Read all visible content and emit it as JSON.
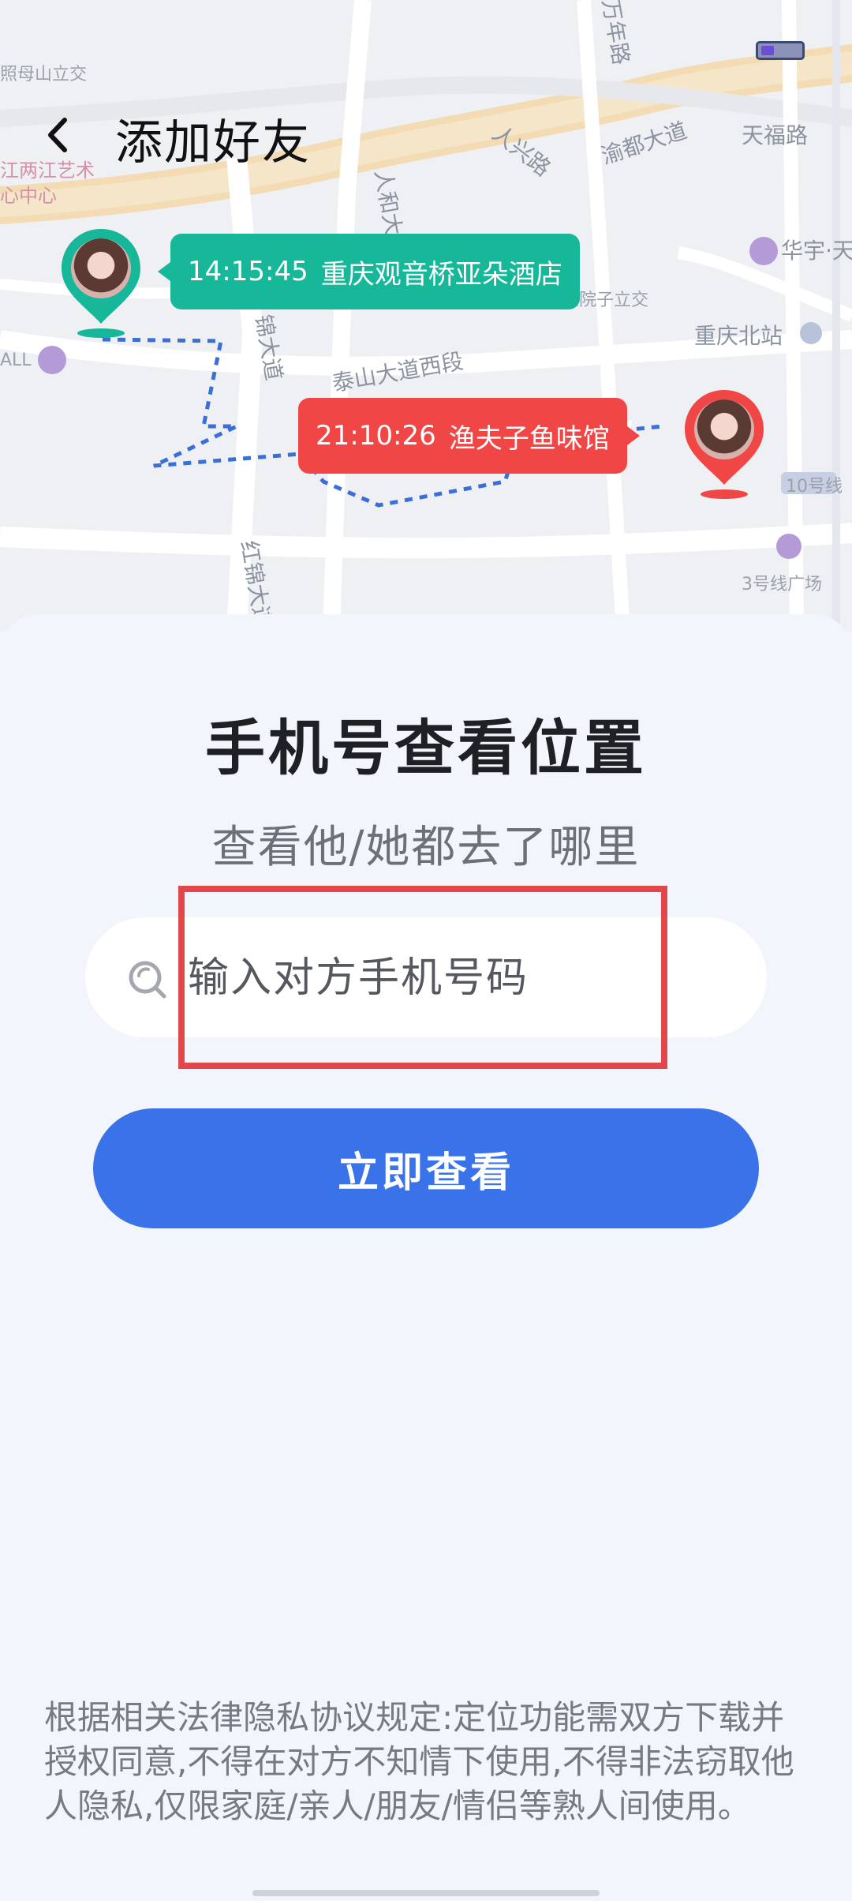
{
  "header": {
    "title": "添加好友"
  },
  "map": {
    "labels": {
      "wanshou_road": "万年路",
      "renxing_road": "人兴路",
      "yudu_avenue": "渝都大道",
      "tianfu_road": "天福路",
      "renhe_avenue": "人和大道",
      "jinjin_avenue": "锦大道",
      "taishan_avenue": "泰山大道西段",
      "hongjin_avenue": "红锦大道",
      "huayu": "华宇·天",
      "chongqing_north": "重庆北站",
      "line3": "3号线广场",
      "line10": "10号线",
      "liangjiang_art": "江两江艺术",
      "center": "心中心",
      "top_left": "照母山立交",
      "liujia": "刘家院子立交",
      "mall": "ALL"
    },
    "markers": [
      {
        "time": "14:15:45",
        "place": "重庆观音桥亚朵酒店",
        "color": "#17b79a"
      },
      {
        "time": "21:10:26",
        "place": "渔夫子鱼味馆",
        "color": "#f04646"
      }
    ]
  },
  "main": {
    "title": "手机号查看位置",
    "subtitle": "查看他/她都去了哪里",
    "search": {
      "placeholder": "输入对方手机号码",
      "value": ""
    },
    "submit_label": "立即查看",
    "disclaimer": "根据相关法律隐私协议规定:定位功能需双方下载并授权同意,不得在对方不知情下使用,不得非法窃取他人隐私,仅限家庭/亲人/朋友/情侣等熟人间使用。"
  }
}
